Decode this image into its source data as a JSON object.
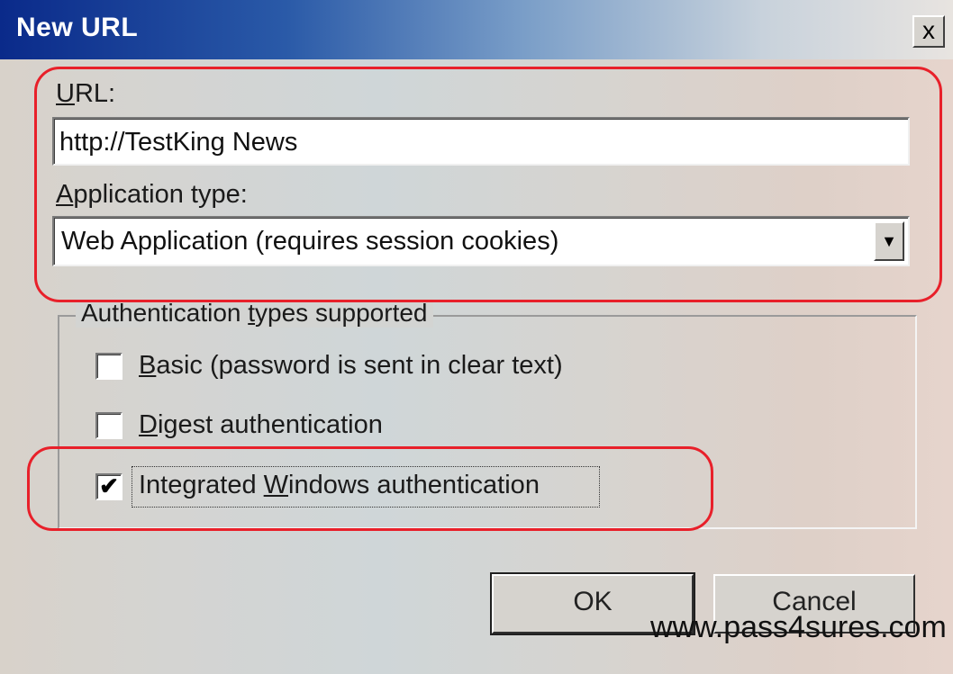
{
  "window": {
    "title": "New URL",
    "close_label": "x"
  },
  "url_field": {
    "label_accel": "U",
    "label_rest": "RL:",
    "value": "http://TestKing News"
  },
  "app_type": {
    "label_accel": "A",
    "label_rest": "pplication type:",
    "selected": "Web Application (requires session cookies)",
    "dropdown_glyph": "▼"
  },
  "auth_group": {
    "title_pre": "Authentication ",
    "title_accel": "t",
    "title_post": "ypes supported",
    "options": [
      {
        "accel": "B",
        "rest": "asic (password is sent in clear text)",
        "checked": false
      },
      {
        "accel": "D",
        "rest": "igest authentication",
        "checked": false
      },
      {
        "pre": "Integrated ",
        "accel": "W",
        "rest": "indows authentication",
        "checked": true
      }
    ],
    "check_glyph": "✔"
  },
  "buttons": {
    "ok": "OK",
    "cancel": "Cancel"
  },
  "watermark": "www.pass4sures.com",
  "colors": {
    "highlight": "#e8202a",
    "title_bar_start": "#0a2a8a",
    "face": "#d6d3ce"
  }
}
